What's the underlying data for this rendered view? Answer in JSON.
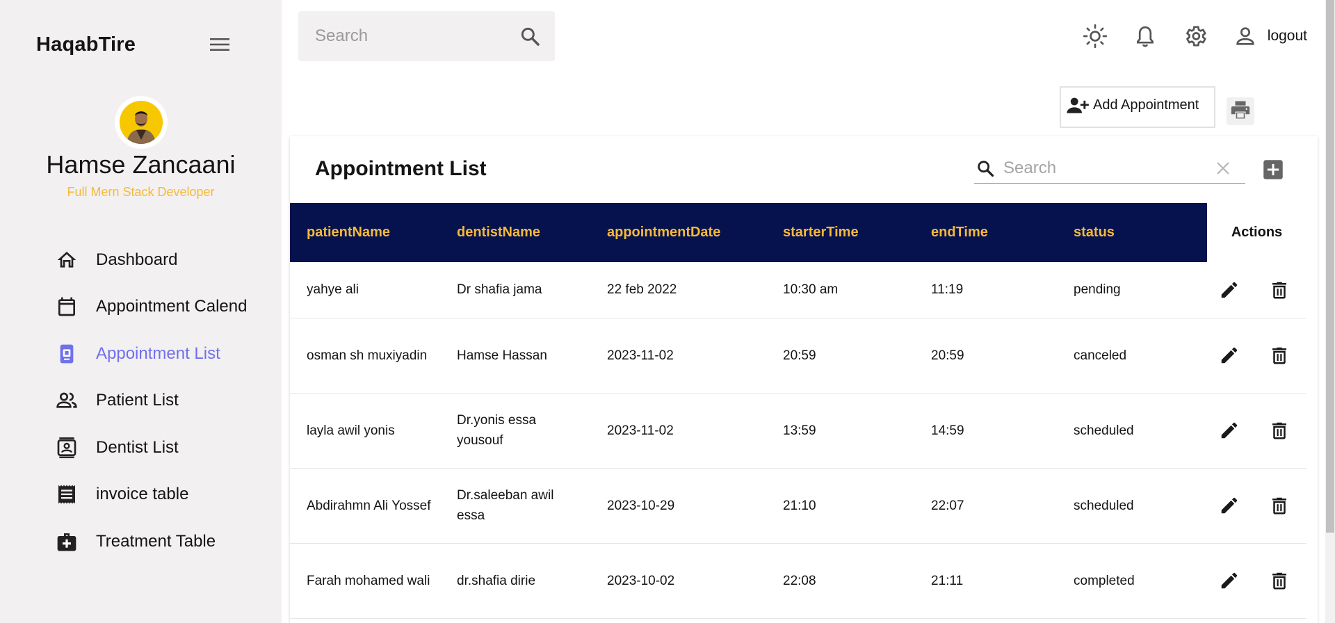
{
  "sidebar": {
    "brand": "HaqabTire",
    "user": {
      "name": "Hamse Zancaani",
      "role": "Full Mern Stack Developer"
    },
    "items": [
      {
        "label": "Dashboard",
        "icon": "home-icon"
      },
      {
        "label": "Appointment Calendar",
        "icon": "calendar-icon"
      },
      {
        "label": "Appointment List",
        "icon": "appointment-list-icon",
        "active": true
      },
      {
        "label": "Patient List",
        "icon": "people-icon"
      },
      {
        "label": "Dentist List",
        "icon": "contact-card-icon"
      },
      {
        "label": "invoice table",
        "icon": "receipt-icon"
      },
      {
        "label": "Treatment Table",
        "icon": "medical-bag-icon"
      }
    ]
  },
  "topbar": {
    "search_placeholder": "Search",
    "logout_label": "logout"
  },
  "actions": {
    "add_appointment_label": "Add Appointment"
  },
  "card": {
    "title": "Appointment List",
    "search_placeholder": "Search"
  },
  "table": {
    "headers": [
      "patientName",
      "dentistName",
      "appointmentDate",
      "starterTime",
      "endTime",
      "status",
      "Actions"
    ],
    "rows": [
      [
        "yahye ali",
        "Dr shafia jama",
        "22 feb 2022",
        "10:30 am",
        "11:19",
        "pending"
      ],
      [
        "osman sh muxiyadin",
        "Hamse Hassan",
        "2023-11-02",
        "20:59",
        "20:59",
        "canceled"
      ],
      [
        "layla awil yonis",
        "Dr.yonis essa yousouf",
        "2023-11-02",
        "13:59",
        "14:59",
        "scheduled"
      ],
      [
        "Abdirahmn Ali Yossef",
        "Dr.saleeban awil essa",
        "2023-10-29",
        "21:10",
        "22:07",
        "scheduled"
      ],
      [
        "Farah mohamed wali",
        "dr.shafia dirie",
        "2023-10-02",
        "22:08",
        "21:11",
        "completed"
      ]
    ]
  },
  "colors": {
    "sidebar_bg": "#f2f0f0",
    "header_bg": "#05124d",
    "header_text": "#f5b93a",
    "accent": "#7070ee",
    "role_text": "#f5b93a"
  }
}
